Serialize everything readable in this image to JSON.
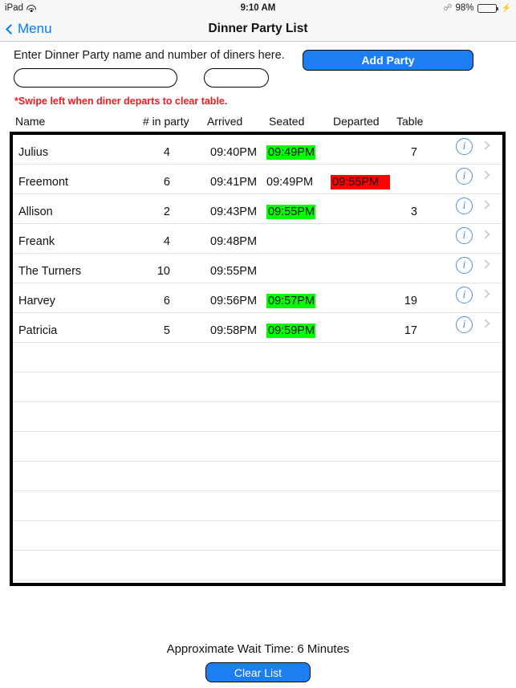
{
  "status_bar": {
    "device": "iPad",
    "wifi_icon": "wifi-icon",
    "time": "9:10 AM",
    "bluetooth_icon": "bluetooth-icon",
    "battery_percent": "98%",
    "battery_level": 98,
    "charging_icon": "lightning-bolt-icon"
  },
  "nav_bar": {
    "back_icon": "chevron-left-icon",
    "back_label": "Menu",
    "title": "Dinner Party List"
  },
  "entry": {
    "instruction": "Enter Dinner Party name and number of diners here.",
    "name_value": "",
    "name_placeholder": "",
    "count_value": "",
    "count_placeholder": "",
    "add_button_label": "Add Party",
    "swipe_note": "*Swipe left when diner departs to clear table."
  },
  "table": {
    "columns": [
      "Name",
      "# in party",
      "Arrived",
      "Seated",
      "Departed",
      "Table"
    ],
    "info_icon": "info-circle-icon",
    "chevron_icon": "chevron-right-icon",
    "rows": [
      {
        "name": "Julius",
        "party": "4",
        "arrived": "09:40PM",
        "seated": "09:49PM",
        "seated_hl": "green",
        "departed": "",
        "departed_hl": "none",
        "table": "7"
      },
      {
        "name": "Freemont",
        "party": "6",
        "arrived": "09:41PM",
        "seated": "09:49PM",
        "seated_hl": "none",
        "departed": "09:55PM",
        "departed_hl": "red",
        "table": ""
      },
      {
        "name": "Allison",
        "party": "2",
        "arrived": "09:43PM",
        "seated": "09:55PM",
        "seated_hl": "green",
        "departed": "",
        "departed_hl": "none",
        "table": "3"
      },
      {
        "name": "Freank",
        "party": "4",
        "arrived": "09:48PM",
        "seated": "",
        "seated_hl": "none",
        "departed": "",
        "departed_hl": "none",
        "table": ""
      },
      {
        "name": "The Turners",
        "party": "10",
        "arrived": "09:55PM",
        "seated": "",
        "seated_hl": "none",
        "departed": "",
        "departed_hl": "none",
        "table": ""
      },
      {
        "name": "Harvey",
        "party": "6",
        "arrived": "09:56PM",
        "seated": "09:57PM",
        "seated_hl": "green",
        "departed": "",
        "departed_hl": "none",
        "table": "19"
      },
      {
        "name": "Patricia",
        "party": "5",
        "arrived": "09:58PM",
        "seated": "09:59PM",
        "seated_hl": "green",
        "departed": "",
        "departed_hl": "none",
        "table": "17"
      }
    ],
    "empty_row_count": 8
  },
  "footer": {
    "wait_time": "Approximate Wait Time: 6 Minutes",
    "clear_button_label": "Clear List"
  },
  "colors": {
    "accent_blue": "#1b7ef2",
    "link_blue": "#007aff",
    "seated_highlight": "#00ff00",
    "departed_highlight": "#ff0000",
    "warning_red": "#ef1b22",
    "battery_green": "#4cd75c"
  }
}
